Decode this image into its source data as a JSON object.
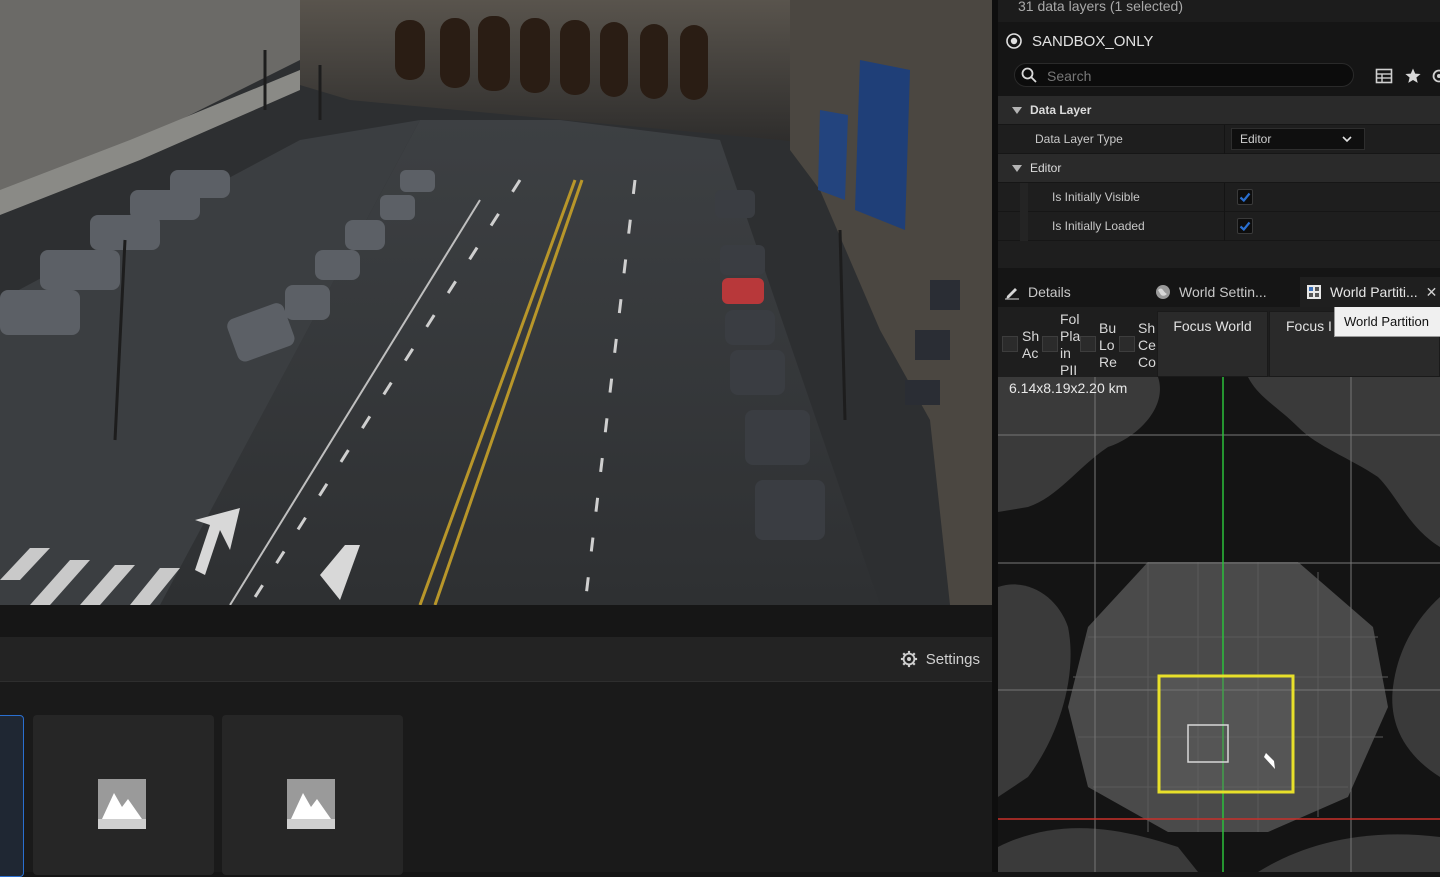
{
  "viewport": {
    "scene": "street"
  },
  "bottom_panel": {
    "settings_label": "Settings",
    "tiles": [
      {
        "icon": "texture-icon"
      },
      {
        "icon": "texture-icon"
      }
    ]
  },
  "data_layers": {
    "count_text": "31 data layers (1 selected)",
    "selected_name": "SANDBOX_ONLY",
    "search_placeholder": "Search",
    "categories": {
      "data_layer": "Data Layer",
      "editor": "Editor"
    },
    "properties": {
      "type_label": "Data Layer Type",
      "type_value": "Editor",
      "visible_label": "Is Initially Visible",
      "visible_checked": true,
      "loaded_label": "Is Initially Loaded",
      "loaded_checked": true
    }
  },
  "tabs": [
    {
      "label": "Details",
      "icon": "pencil-icon"
    },
    {
      "label": "World Settin...",
      "icon": "globe-icon"
    },
    {
      "label": "World Partiti...",
      "icon": "grid-icon",
      "active": true
    }
  ],
  "world_partition": {
    "toolbar": {
      "show_actors": [
        "Sh",
        "Ac"
      ],
      "follow_player": [
        "Fol",
        "Pla",
        "in",
        "PII"
      ],
      "bugitgo": [
        "Bu",
        "Lo",
        "Re"
      ],
      "show_cells": [
        "Sh",
        "Ce",
        "Co"
      ],
      "focus_world": "Focus World",
      "focus_selection": "Focus I",
      "tooltip": "World Partition"
    },
    "dimensions": "6.14x8.19x2.20 km"
  },
  "colors": {
    "accent": "#2a6fd0",
    "selection": "#e8e02a",
    "axis_green": "#2bbf3a",
    "axis_red": "#c8302a"
  }
}
